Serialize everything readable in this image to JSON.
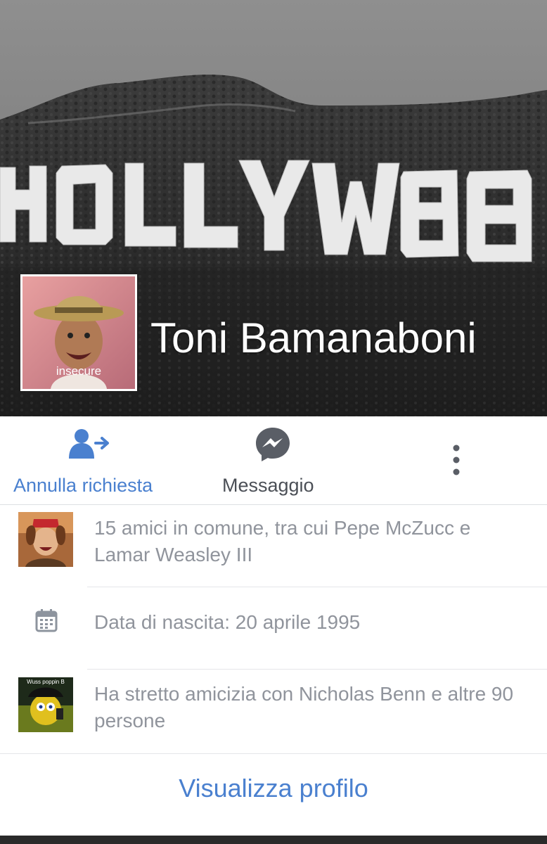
{
  "profile": {
    "name": "Toni Bamanaboni",
    "avatar_caption": "insecure",
    "cover_sign_text": "HOLLYWEE"
  },
  "actions": {
    "cancel_request": {
      "label": "Annulla richiesta",
      "icon": "user-cancel-request-icon"
    },
    "message": {
      "label": "Messaggio",
      "icon": "messenger-icon"
    },
    "more": {
      "icon": "more-vertical-icon"
    }
  },
  "info": {
    "mutual_friends": "15 amici in comune, tra cui Pepe McZucc e Lamar Weasley III",
    "birthday": "Data di nascita: 20 aprile 1995",
    "friendship": "Ha stretto amicizia con Nicholas Benn e altre 90 persone",
    "friendship_thumb_caption": "Wuss poppin B"
  },
  "footer": {
    "view_profile": "Visualizza profilo"
  },
  "colors": {
    "accent": "#4a80cf",
    "secondary_text": "#90949c",
    "dark_text": "#4b4f56",
    "divider": "#e5e6e9"
  }
}
